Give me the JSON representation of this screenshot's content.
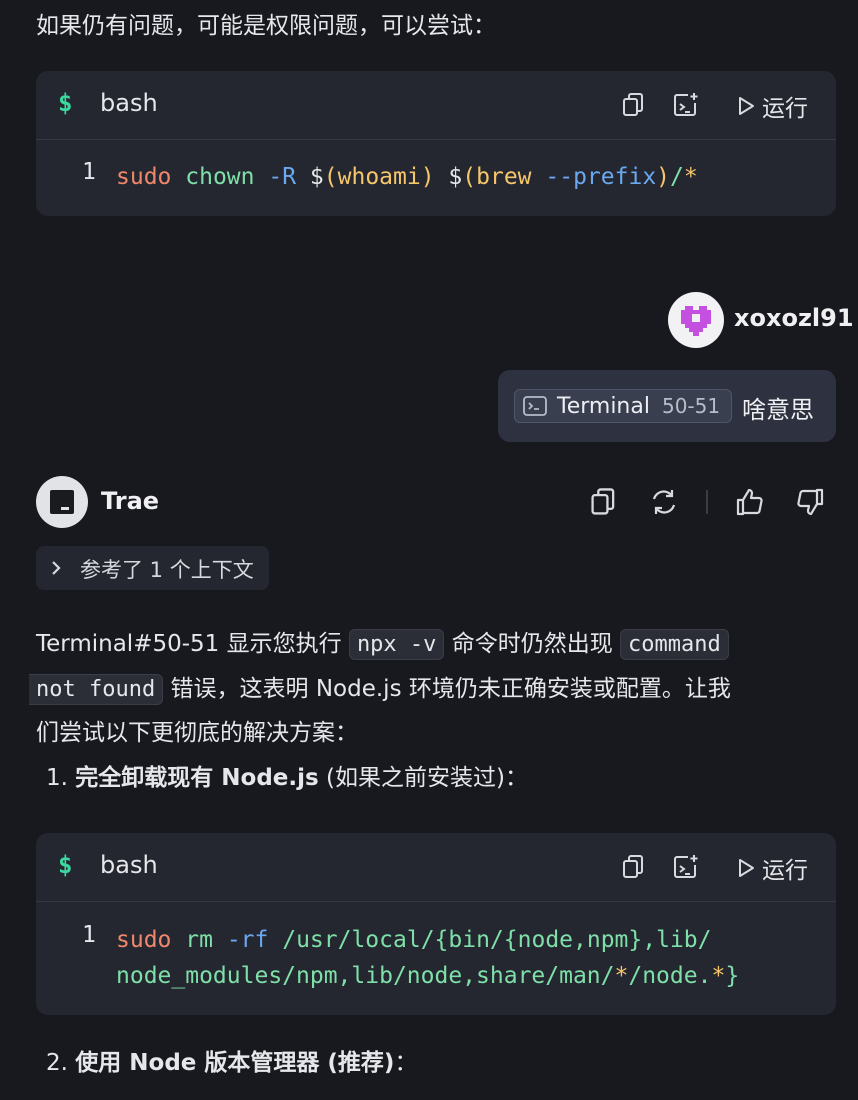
{
  "intro_text": "如果仍有问题，可能是权限问题，可以尝试：",
  "code_block_1": {
    "dollar": "$",
    "language": "bash",
    "run_label": "运行",
    "line_number": "1",
    "tokens": [
      {
        "t": "sudo",
        "c": "k-cmd"
      },
      {
        "t": " ",
        "c": "k-plain"
      },
      {
        "t": "chown",
        "c": "k-arg"
      },
      {
        "t": " ",
        "c": "k-plain"
      },
      {
        "t": "-R",
        "c": "k-flag"
      },
      {
        "t": " $",
        "c": "k-plain"
      },
      {
        "t": "(",
        "c": "k-paren"
      },
      {
        "t": "whoami",
        "c": "k-sub"
      },
      {
        "t": ")",
        "c": "k-paren"
      },
      {
        "t": " $",
        "c": "k-plain"
      },
      {
        "t": "(",
        "c": "k-paren"
      },
      {
        "t": "brew",
        "c": "k-sub"
      },
      {
        "t": " ",
        "c": "k-plain"
      },
      {
        "t": "--prefix",
        "c": "k-flag"
      },
      {
        "t": ")",
        "c": "k-paren"
      },
      {
        "t": "/",
        "c": "k-arg"
      },
      {
        "t": "*",
        "c": "k-paren"
      }
    ]
  },
  "user": {
    "name": "xoxozl91",
    "chip_label": "Terminal",
    "chip_range": "50-51",
    "message": "啥意思"
  },
  "assistant": {
    "name": "Trae",
    "context_label": "参考了 1 个上下文",
    "p1_a": "Terminal#50-51 显示您执行",
    "p1_code1": "npx -v",
    "p1_b": "命令时仍然出现",
    "p1_code2a": "command",
    "p1_code2b": "not found",
    "p1_c": "错误，这表明 Node.js 环境仍未正确安装或配置。让我",
    "p1_d": "们尝试以下更彻底的解决方案：",
    "step1_num": "1.",
    "step1_bold": "完全卸载现有 Node.js",
    "step1_rest": "(如果之前安装过)：",
    "step2_num": "2.",
    "step2_bold": "使用 Node 版本管理器 (推荐)",
    "step2_rest": "："
  },
  "code_block_2": {
    "dollar": "$",
    "language": "bash",
    "run_label": "运行",
    "line_number": "1",
    "line1_tokens": [
      {
        "t": "sudo",
        "c": "k-cmd"
      },
      {
        "t": " ",
        "c": "k-plain"
      },
      {
        "t": "rm",
        "c": "k-arg"
      },
      {
        "t": " ",
        "c": "k-plain"
      },
      {
        "t": "-rf",
        "c": "k-flag"
      },
      {
        "t": " ",
        "c": "k-plain"
      },
      {
        "t": "/usr/local/{bin/{node,npm},lib/",
        "c": "k-arg"
      }
    ],
    "line2_tokens": [
      {
        "t": "node_modules/npm,lib/node,share/man/",
        "c": "k-arg"
      },
      {
        "t": "*",
        "c": "k-paren"
      },
      {
        "t": "/node.",
        "c": "k-arg"
      },
      {
        "t": "*",
        "c": "k-paren"
      },
      {
        "t": "}",
        "c": "k-arg"
      }
    ]
  },
  "colors": {
    "background": "#18191e",
    "code_bg": "#252730",
    "bubble_bg": "#2d3140",
    "accent_green": "#3bd8a0",
    "avatar_purple": "#c450e0"
  },
  "icons": [
    "copy-icon",
    "insert-to-terminal-icon",
    "play-icon",
    "terminal-chip-icon",
    "refresh-icon",
    "thumbs-up-icon",
    "thumbs-down-icon",
    "chevron-right-icon"
  ]
}
